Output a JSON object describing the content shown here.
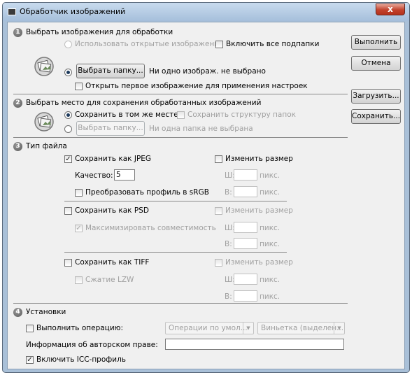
{
  "window": {
    "title": "Обработчик изображений",
    "close_glyph": "x"
  },
  "icons": {
    "title": "app-icon",
    "close": "close-icon",
    "source": "photo-source-icon",
    "destination": "save-destination-icon"
  },
  "colors": {
    "frame": "#a9c0d8",
    "close": "#c2422c",
    "client": "#f0f0f0"
  },
  "section1": {
    "num": "1",
    "title": "Выбрать изображения для обработки",
    "open_images": {
      "label": "Использовать открытые изображения",
      "checked": false,
      "enabled": false
    },
    "include_subfolders": {
      "label": "Включить все подпапки",
      "checked": false
    },
    "select_folder": {
      "label": "Выбрать папку...",
      "checked": true
    },
    "status": "Ни одно изображ. не выбрано",
    "open_first": {
      "label": "Открыть первое изображение для применения настроек",
      "checked": false
    }
  },
  "section2": {
    "num": "2",
    "title": "Выбрать место для сохранения обработанных изображений",
    "same_location": {
      "label": "Сохранить в том же месте",
      "checked": true
    },
    "keep_structure": {
      "label": "Сохранить структуру папок",
      "checked": false,
      "enabled": false
    },
    "select_folder": {
      "label": "Выбрать папку...",
      "enabled": false
    },
    "status": "Ни одна папка не выбрана"
  },
  "section3": {
    "num": "3",
    "title": "Тип файла",
    "jpeg": {
      "label": "Сохранить как JPEG",
      "checked": true,
      "quality_label": "Качество:",
      "quality_value": "5",
      "convert_srgb": "Преобразовать профиль в sRGB",
      "resize": "Изменить размер",
      "w": "Ш:",
      "h": "В:",
      "unit": "пикс."
    },
    "psd": {
      "label": "Сохранить как PSD",
      "checked": false,
      "max_compat": "Максимизировать совместимость",
      "resize": "Изменить размер",
      "w": "Ш:",
      "h": "В:",
      "unit": "пикс."
    },
    "tiff": {
      "label": "Сохранить как TIFF",
      "checked": false,
      "lzw": "Сжатие LZW",
      "resize": "Изменить размер",
      "w": "Ш:",
      "h": "В:",
      "unit": "пикс."
    }
  },
  "section4": {
    "num": "4",
    "title": "Установки",
    "run_action": {
      "label": "Выполнить операцию:",
      "checked": false
    },
    "action_set": "Операции по умол...",
    "action": "Виньетка (выделен...",
    "copyright_label": "Информация об авторском праве:",
    "copyright_value": "",
    "icc": {
      "label": "Включить ICC-профиль",
      "checked": true
    }
  },
  "buttons": {
    "run": "Выполнить",
    "cancel": "Отмена",
    "load": "Загрузить...",
    "save": "Сохранить..."
  }
}
